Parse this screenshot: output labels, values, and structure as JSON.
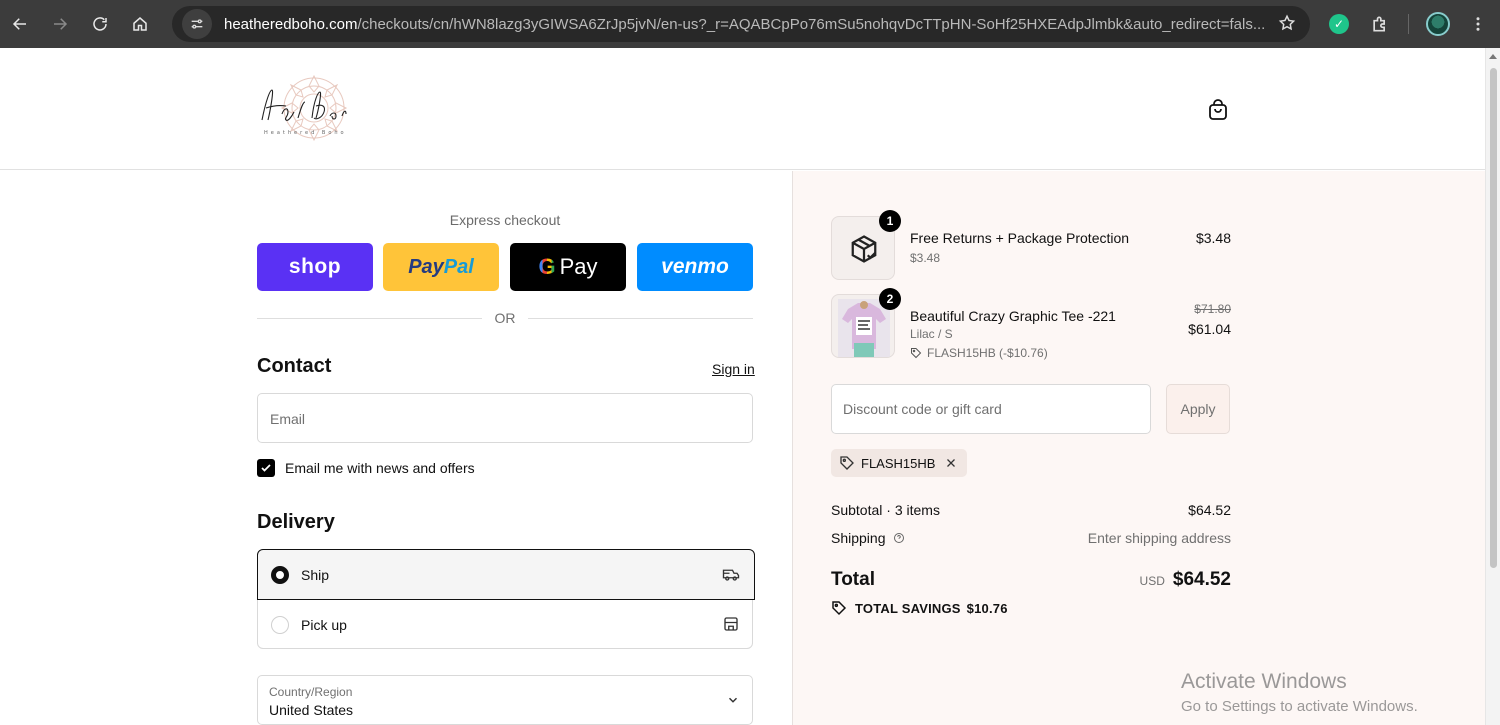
{
  "browser": {
    "url_host": "heatheredboho.com",
    "url_rest": "/checkouts/cn/hWN8lazg3yGIWSA6ZrJp5jvN/en-us?_r=AQABCpPo76mSu5nohqvDcTTpHN-SoHf25HXEAdpJlmbk&auto_redirect=fals..."
  },
  "store": {
    "logo_text": "Heathered Boho"
  },
  "express": {
    "title": "Express checkout",
    "shop_label": "shop",
    "paypal_a": "Pay",
    "paypal_b": "Pal",
    "gpay_g": "G",
    "gpay_label": "Pay",
    "venmo_label": "venmo",
    "or_label": "OR"
  },
  "contact": {
    "title": "Contact",
    "sign_in": "Sign in",
    "email_placeholder": "Email",
    "newsletter_label": "Email me with news and offers"
  },
  "delivery": {
    "title": "Delivery",
    "ship_label": "Ship",
    "pickup_label": "Pick up",
    "country_caption": "Country/Region",
    "country_value": "United States"
  },
  "cart": {
    "items": [
      {
        "qty": "1",
        "name": "Free Returns + Package Protection",
        "sub": "$3.48",
        "price": "$3.48"
      },
      {
        "qty": "2",
        "name": "Beautiful Crazy Graphic Tee -221",
        "variant": "Lilac / S",
        "discount": "FLASH15HB (-$10.76)",
        "original_price": "$71.80",
        "price": "$61.04"
      }
    ],
    "discount_placeholder": "Discount code or gift card",
    "apply_label": "Apply",
    "applied_code": "FLASH15HB",
    "subtotal_label": "Subtotal · 3 items",
    "subtotal_value": "$64.52",
    "shipping_label": "Shipping",
    "shipping_value": "Enter shipping address",
    "total_label": "Total",
    "currency": "USD",
    "total_value": "$64.52",
    "savings_label": "TOTAL SAVINGS",
    "savings_value": "$10.76"
  },
  "watermark": {
    "line1": "Activate Windows",
    "line2": "Go to Settings to activate Windows."
  },
  "colors": {
    "shop": "#5a31f4",
    "paypal": "#ffc439",
    "venmo": "#008cff",
    "summary_bg": "#fdf7f5"
  }
}
